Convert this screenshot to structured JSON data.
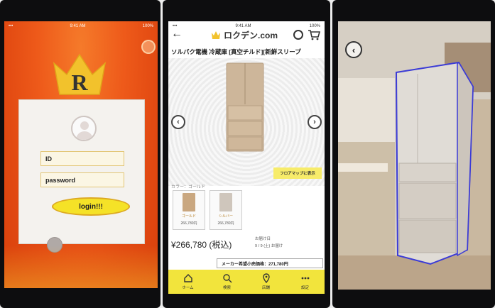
{
  "status_bar": {
    "time": "9:41 AM",
    "battery": "100%"
  },
  "login_screen": {
    "logo_letter": "R",
    "id_placeholder": "ID",
    "password_placeholder": "password",
    "login_label": "login!!!"
  },
  "shop_screen": {
    "brand_name": "ロクデン.com",
    "product_title": "ソルパク電機 冷蔵庫 [真空チルド][新鮮スリープ",
    "floormap_button": "フロアマップに表示",
    "color_label": "カラー：ゴールド",
    "swatches": [
      {
        "name": "ゴールド",
        "price": "266,780円"
      },
      {
        "name": "シルバー",
        "price": "266,780円"
      }
    ],
    "price": "¥266,780 (税込)",
    "delivery_label": "お届け日",
    "delivery_value": "9 / 9 (土) お届け",
    "maker_price": "メーカー希望小売価格：271,780円",
    "tabs": [
      {
        "icon": "home-icon",
        "label": "ホーム"
      },
      {
        "icon": "search-icon",
        "label": "検索"
      },
      {
        "icon": "location-pin-icon",
        "label": "店舗"
      },
      {
        "icon": "more-icon",
        "label": "設定"
      }
    ]
  },
  "ar_screen": {
    "back_glyph": "‹"
  },
  "colors": {
    "login_orange": "#ee5a1a",
    "crown_gold": "#f2c22c",
    "shop_yellow": "#f2e43c",
    "ar_outline": "#3b3bd6"
  }
}
